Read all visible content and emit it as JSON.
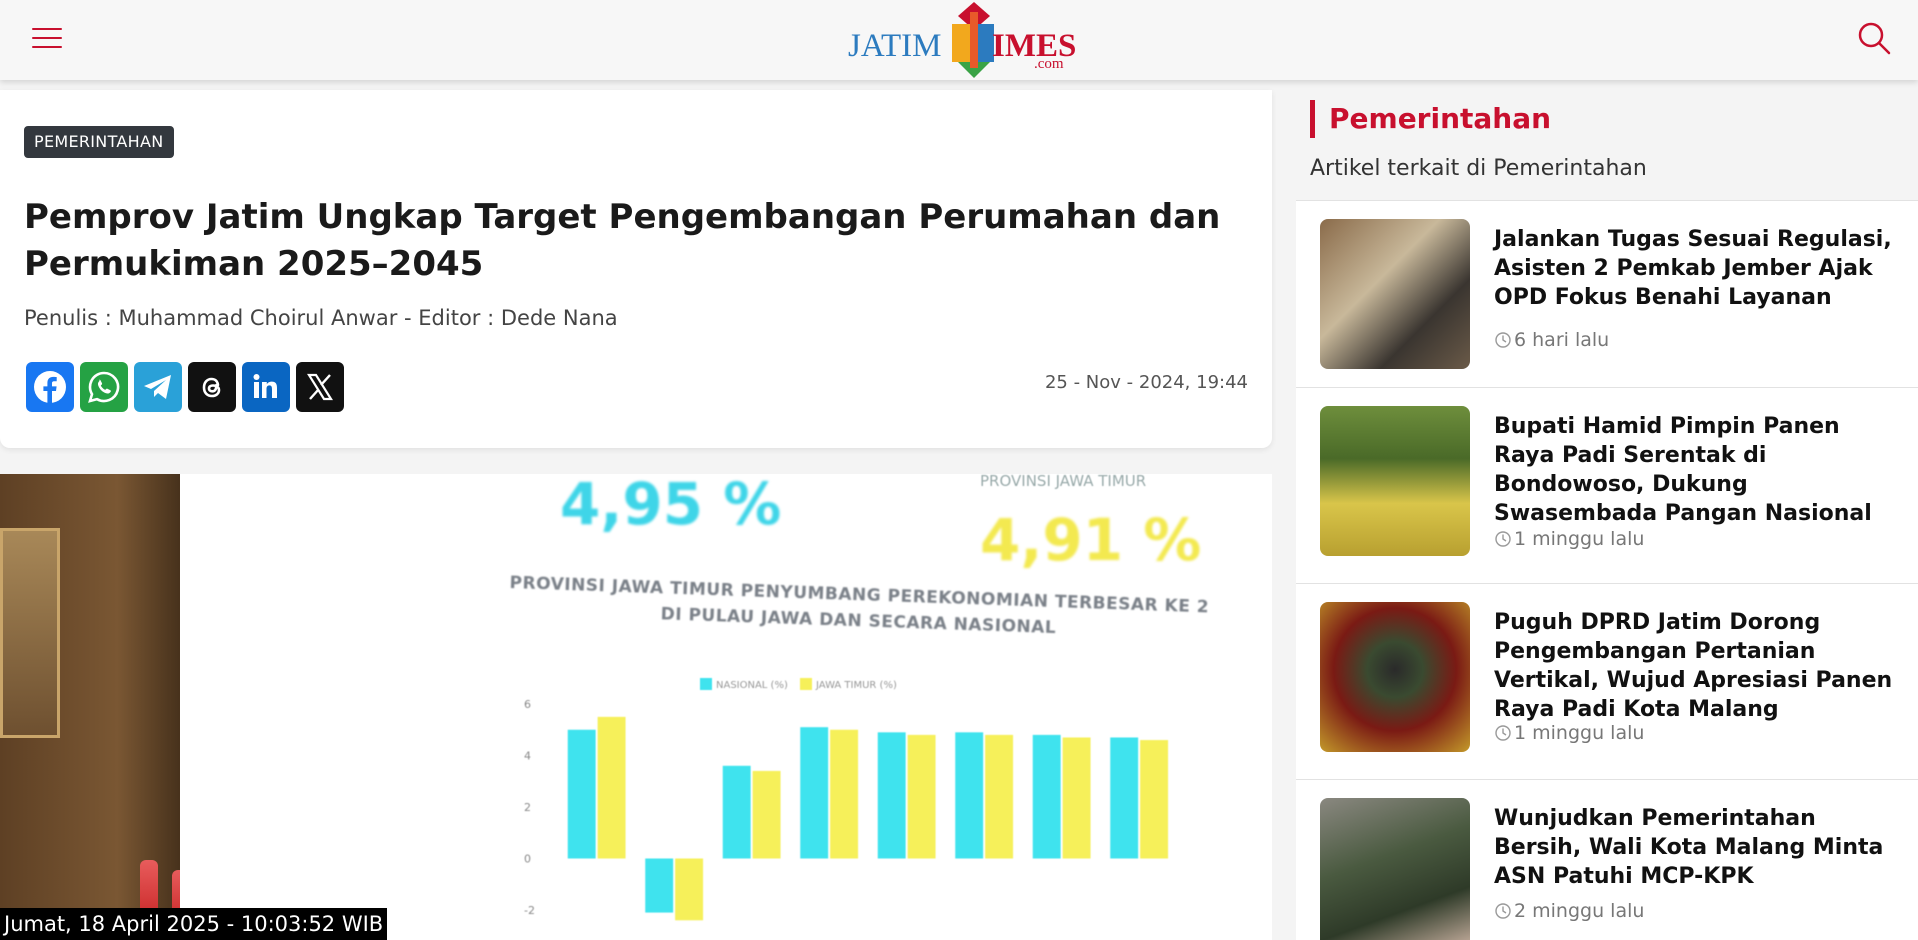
{
  "header": {
    "menu_icon": "hamburger-icon",
    "logo": {
      "left": "JATIM",
      "right": "IMES",
      "suffix": ".com"
    },
    "search_icon": "search-icon"
  },
  "article": {
    "category": "PEMERINTAHAN",
    "title": "Pemprov Jatim Ungkap Target Pengembangan Perumahan dan Permukiman 2025–2045",
    "byline": "Penulis : Muhammad Choirul Anwar - Editor : Dede Nana",
    "published": "25 - Nov - 2024, 19:44",
    "share": [
      {
        "name": "facebook",
        "icon": "facebook-icon",
        "color": "#1877f2"
      },
      {
        "name": "whatsapp",
        "icon": "whatsapp-icon",
        "color": "#25a244"
      },
      {
        "name": "telegram",
        "icon": "telegram-icon",
        "color": "#2aa1d8"
      },
      {
        "name": "threads",
        "icon": "threads-icon",
        "color": "#111111"
      },
      {
        "name": "linkedin",
        "icon": "linkedin-icon",
        "color": "#0a66c2"
      },
      {
        "name": "x",
        "icon": "x-icon",
        "color": "#111111"
      }
    ]
  },
  "hero": {
    "stat_national": "4,95 %",
    "stat_jatim_label": "PROVINSI JAWA TIMUR",
    "stat_jatim": "4,91 %",
    "chart_heading": "PROVINSI JAWA TIMUR PENYUMBANG PEREKONOMIAN TERBESAR KE 2 DI PULAU JAWA DAN SECARA NASIONAL",
    "timestamp": "Jumat, 18 April 2025 - 10:03:52 WIB"
  },
  "chart_data": {
    "type": "bar",
    "legend": [
      "NASIONAL (%)",
      "JAWA TIMUR (%)"
    ],
    "yticks": [
      "6",
      "4",
      "2",
      "0",
      "-2"
    ],
    "ylim": [
      -2,
      6
    ],
    "series": [
      {
        "name": "NASIONAL (%)",
        "color": "#3fe3ee",
        "values": [
          5.0,
          -2.1,
          3.6,
          5.1,
          4.9,
          4.9,
          4.8,
          4.7
        ]
      },
      {
        "name": "JAWA TIMUR (%)",
        "color": "#f6f05a",
        "values": [
          5.5,
          -2.4,
          3.4,
          5.0,
          4.8,
          4.8,
          4.7,
          4.6
        ]
      }
    ]
  },
  "sidebar": {
    "heading": "Pemerintahan",
    "subheading": "Artikel terkait di Pemerintahan",
    "items": [
      {
        "title": "Jalankan Tugas Sesuai Regulasi, Asisten 2 Pemkab Jember Ajak OPD Fokus Benahi Layanan",
        "time": "6 hari lalu"
      },
      {
        "title": "Bupati Hamid Pimpin Panen Raya Padi Serentak di Bondowoso, Dukung Swasembada Pangan Nasional",
        "time": "1 minggu lalu"
      },
      {
        "title": "Puguh DPRD Jatim Dorong Pengembangan Pertanian Vertikal, Wujud Apresiasi Panen Raya Padi Kota Malang",
        "time": "1 minggu lalu"
      },
      {
        "title": "Wunjudkan Pemerintahan Bersih, Wali Kota Malang Minta ASN Patuhi MCP-KPK",
        "time": "2 minggu lalu"
      }
    ]
  }
}
